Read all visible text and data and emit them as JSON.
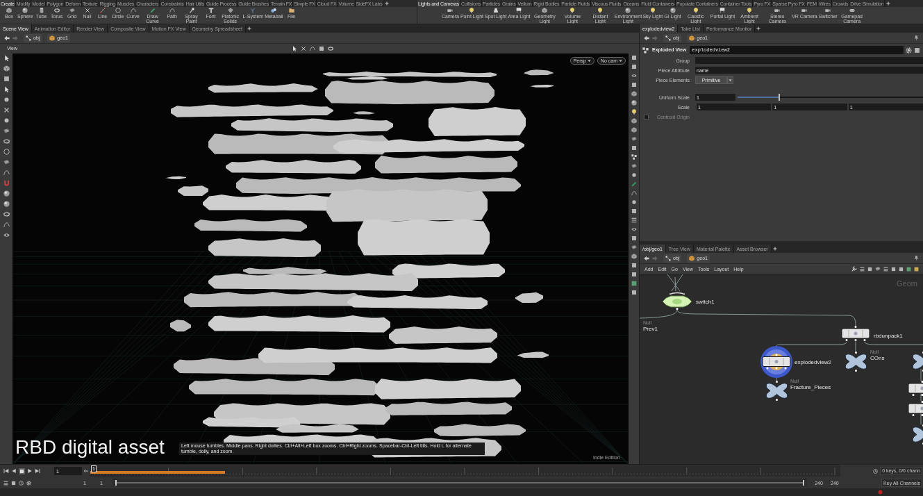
{
  "shelves": [
    {
      "tabs": [
        {
          "label": "Create",
          "selected": true
        },
        {
          "label": "Modify",
          "selected": false
        },
        {
          "label": "Model",
          "selected": false
        },
        {
          "label": "Polygon",
          "selected": false
        },
        {
          "label": "Deform",
          "selected": false
        },
        {
          "label": "Texture",
          "selected": false
        },
        {
          "label": "Rigging",
          "selected": false
        },
        {
          "label": "Muscles",
          "selected": false
        },
        {
          "label": "Characters",
          "selected": false
        },
        {
          "label": "Constraints",
          "selected": false
        },
        {
          "label": "Hair Utils",
          "selected": false
        },
        {
          "label": "Guide Process",
          "selected": false
        },
        {
          "label": "Guide Brushes",
          "selected": false
        },
        {
          "label": "Terrain FX",
          "selected": false
        },
        {
          "label": "Simple FX",
          "selected": false
        },
        {
          "label": "Cloud FX",
          "selected": false
        },
        {
          "label": "Volume",
          "selected": false
        },
        {
          "label": "SideFX Labs",
          "selected": false
        }
      ],
      "tools": [
        {
          "label": "Box"
        },
        {
          "label": "Sphere"
        },
        {
          "label": "Tube"
        },
        {
          "label": "Torus"
        },
        {
          "label": "Grid"
        },
        {
          "label": "Null"
        },
        {
          "label": "Line"
        },
        {
          "label": "Circle"
        },
        {
          "label": "Curve"
        },
        {
          "label": "Draw Curve"
        },
        {
          "label": "Path"
        },
        {
          "label": "Spray Paint"
        },
        {
          "label": "Font"
        },
        {
          "label": "Platonic Solids"
        },
        {
          "label": "L-System"
        },
        {
          "label": "Metaball"
        },
        {
          "label": "File"
        }
      ]
    },
    {
      "tabs": [
        {
          "label": "Lights and Cameras",
          "selected": true
        },
        {
          "label": "Collisions",
          "selected": false
        },
        {
          "label": "Particles",
          "selected": false
        },
        {
          "label": "Grains",
          "selected": false
        },
        {
          "label": "Vellum",
          "selected": false
        },
        {
          "label": "Rigid Bodies",
          "selected": false
        },
        {
          "label": "Particle Fluids",
          "selected": false
        },
        {
          "label": "Viscous Fluids",
          "selected": false
        },
        {
          "label": "Oceans",
          "selected": false
        },
        {
          "label": "Fluid Containers",
          "selected": false
        },
        {
          "label": "Populate Containers",
          "selected": false
        },
        {
          "label": "Container Tools",
          "selected": false
        },
        {
          "label": "Pyro FX",
          "selected": false
        },
        {
          "label": "Sparse Pyro FX",
          "selected": false
        },
        {
          "label": "FEM",
          "selected": false
        },
        {
          "label": "Wires",
          "selected": false
        },
        {
          "label": "Crowds",
          "selected": false
        },
        {
          "label": "Drive Simulation",
          "selected": false
        }
      ],
      "tools": [
        {
          "label": "Camera"
        },
        {
          "label": "Point Light"
        },
        {
          "label": "Spot Light"
        },
        {
          "label": "Area Light"
        },
        {
          "label": "Geometry Light"
        },
        {
          "label": "Volume Light"
        },
        {
          "label": "Distant Light"
        },
        {
          "label": "Environment Light"
        },
        {
          "label": "Sky Light"
        },
        {
          "label": "GI Light"
        },
        {
          "label": "Caustic Light"
        },
        {
          "label": "Portal Light"
        },
        {
          "label": "Ambient Light"
        },
        {
          "label": "Stereo Camera"
        },
        {
          "label": "VR Camera"
        },
        {
          "label": "Switcher"
        },
        {
          "label": "Gamepad Camera"
        }
      ]
    }
  ],
  "scene_view": {
    "tabs": [
      {
        "label": "Scene View",
        "selected": true
      },
      {
        "label": "Animation Editor",
        "selected": false
      },
      {
        "label": "Render View",
        "selected": false
      },
      {
        "label": "Composite View",
        "selected": false
      },
      {
        "label": "Motion FX View",
        "selected": false
      },
      {
        "label": "Geometry Spreadsheet",
        "selected": false
      }
    ],
    "path": [
      "obj",
      "geo1"
    ],
    "title": "View",
    "camera_menus": [
      "Persp",
      "No cam"
    ],
    "hint": "Left mouse tumbles. Middle pans. Right dollies. Ctrl+Alt+Left box zooms. Ctrl+Right zooms. Spacebar-Ctrl-Left tilts. Hold L for alternate tumble, dolly, and zoom.",
    "edition": "Indie Edition",
    "caption": "RBD digital asset"
  },
  "parameter_editor": {
    "tabs": [
      {
        "label": "explodedview2",
        "selected": true
      },
      {
        "label": "Take List",
        "selected": false
      },
      {
        "label": "Performance Monitor",
        "selected": false
      }
    ],
    "path": [
      "obj",
      "geo1"
    ],
    "node_type": "Exploded View",
    "node_name": "explodedview2",
    "parameters": [
      {
        "kind": "text",
        "label": "Group",
        "disabled": false
      },
      {
        "kind": "text",
        "label": "Piece Attribute",
        "value": "name",
        "disabled": false
      },
      {
        "kind": "menu",
        "label": "Piece Elements",
        "value": "Primitive",
        "disabled": false
      },
      {
        "kind": "slider",
        "label": "Uniform Scale",
        "value": "1",
        "level": 0.22,
        "disabled": false
      },
      {
        "kind": "vector",
        "label": "Scale",
        "values": [
          "1",
          "1",
          "1"
        ],
        "disabled": false
      },
      {
        "kind": "toggle",
        "label": "Centroid Origin",
        "checked": false,
        "disabled": true
      }
    ]
  },
  "network_editor": {
    "tabs": [
      {
        "label": "/obj/geo1",
        "selected": true
      },
      {
        "label": "Tree View",
        "selected": false
      },
      {
        "label": "Material Palette",
        "selected": false
      },
      {
        "label": "Asset Browser",
        "selected": false
      }
    ],
    "path": [
      "obj",
      "geo1"
    ],
    "menu": [
      "Add",
      "Edit",
      "Go",
      "View",
      "Tools",
      "Layout",
      "Help"
    ],
    "context": "Geom",
    "nodes": [
      {
        "kind": "switch",
        "name": "switch1",
        "selected": false
      },
      {
        "type_label": "Null",
        "name": "Prev1",
        "selected": false
      },
      {
        "kind": "sop",
        "name": "rbdunpack1",
        "selected": false
      },
      {
        "kind": "sop",
        "name": "explodedview2",
        "selected": true
      },
      {
        "kind": "null",
        "type_label": "Null",
        "name": "COns",
        "selected": false
      },
      {
        "kind": "null",
        "type_label": "Null",
        "name": "Fracture_Pieces",
        "selected": false
      },
      {
        "kind": "null",
        "selected": false
      },
      {
        "kind": "sop",
        "selected": false
      },
      {
        "kind": "sop",
        "selected": false
      },
      {
        "kind": "null",
        "selected": false
      }
    ]
  },
  "timeline": {
    "frame": "1",
    "marker": "1",
    "cache": {
      "level": 0.18
    },
    "start": "1",
    "range_start": "1",
    "range_bar": {
      "level": 1
    },
    "range_end": "240",
    "end": "240",
    "keys_info": "0 keys, 0/0 chann",
    "key_button": "Key All Channels"
  }
}
